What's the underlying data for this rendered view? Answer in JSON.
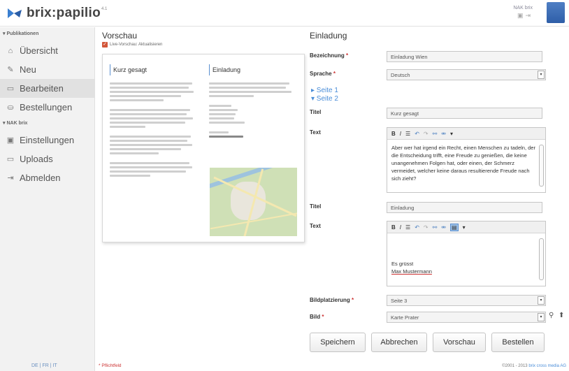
{
  "header": {
    "logo_text": "brix:papilio",
    "logo_version": "4.1",
    "user_name": "NAK brix"
  },
  "sidebar": {
    "groups": [
      {
        "label": "▾ Publikationen"
      },
      {
        "label": "▾ NAK brix"
      }
    ],
    "items": [
      {
        "label": "Übersicht",
        "icon": "home-icon",
        "glyph": "⌂"
      },
      {
        "label": "Neu",
        "icon": "new-document-icon",
        "glyph": "✎"
      },
      {
        "label": "Bearbeiten",
        "icon": "edit-icon",
        "glyph": "▭"
      },
      {
        "label": "Bestellungen",
        "icon": "orders-icon",
        "glyph": "⛀"
      },
      {
        "label": "Einstellungen",
        "icon": "settings-icon",
        "glyph": "▣"
      },
      {
        "label": "Uploads",
        "icon": "upload-icon",
        "glyph": "▭"
      },
      {
        "label": "Abmelden",
        "icon": "logout-icon",
        "glyph": "⇥"
      }
    ],
    "languages": "DE | FR | IT"
  },
  "preview": {
    "title": "Vorschau",
    "live_label": "Live-Vorschau: Aktualisieren",
    "page_left_title": "Kurz gesagt",
    "page_right_title": "Einladung"
  },
  "form": {
    "title": "Einladung",
    "bezeichnung_label": "Bezeichnung",
    "bezeichnung_value": "Einladung Wien",
    "sprache_label": "Sprache",
    "sprache_value": "Deutsch",
    "page1_link": "▸ Seite 1",
    "page2_link": "▾ Seite 2",
    "titel1_label": "Titel",
    "titel1_value": "Kurz gesagt",
    "text1_label": "Text",
    "text1_value": "Aber wer hat irgend ein Recht, einen Menschen zu tadeln, der die Entscheidung trifft, eine Freude zu genießen, die keine unangenehmen Folgen hat, oder einen, der Schmerz vermeidet, welcher keine daraus resultierende Freude nach sich zieht?",
    "titel2_label": "Titel",
    "titel2_value": "Einladung",
    "text2_label": "Text",
    "text2_line1": "Es grüsst",
    "text2_line2": "Max Mustermann",
    "bildplatzierung_label": "Bildplatzierung",
    "bildplatzierung_value": "Seite 3",
    "bild_label": "Bild",
    "bild_value": "Karte Prater",
    "required_marker": "*"
  },
  "buttons": {
    "save": "Speichern",
    "cancel": "Abbrechen",
    "preview": "Vorschau",
    "order": "Bestellen"
  },
  "footer": {
    "required_note": "* Pflichtfeld",
    "copyright": "©2001 - 2013",
    "company": "brix cross media AG"
  }
}
